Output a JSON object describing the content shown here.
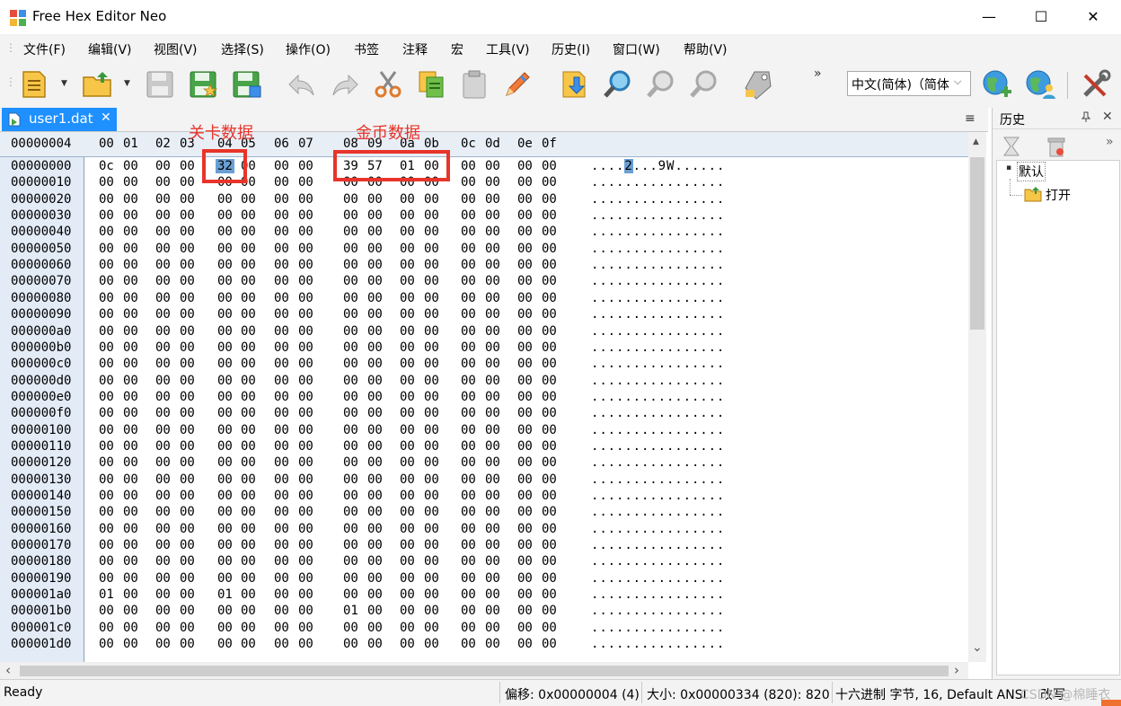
{
  "window": {
    "title": "Free Hex Editor Neo",
    "minimize_glyph": "—",
    "maximize_glyph": "☐",
    "close_glyph": "✕"
  },
  "menu": [
    "文件(F)",
    "编辑(V)",
    "视图(V)",
    "选择(S)",
    "操作(O)",
    "书签",
    "注释",
    "宏",
    "工具(V)",
    "历史(I)",
    "窗口(W)",
    "帮助(V)"
  ],
  "toolbar": {
    "icons": [
      "new-file-icon",
      "open-folder-icon",
      "save-disk-icon",
      "save-as-icon",
      "save-all-icon",
      "undo-icon",
      "redo-icon",
      "cut-scissors-icon",
      "copy-icon",
      "paste-icon",
      "edit-pencil-icon",
      "export-icon",
      "find-icon",
      "find-previous-icon",
      "find-next-icon",
      "tag-icon",
      "web-add-icon",
      "web-user-icon",
      "tools-icon"
    ],
    "overflow": "»",
    "language_select": "中文(简体)（简体",
    "language_chevron": "⌵"
  },
  "tab": {
    "label": "user1.dat",
    "close": "✕",
    "menu": "≡"
  },
  "hex": {
    "corner_offset": "00000004",
    "columns": [
      "00",
      "01",
      "02",
      "03",
      "04",
      "05",
      "06",
      "07",
      "08",
      "09",
      "0a",
      "0b",
      "0c",
      "0d",
      "0e",
      "0f"
    ],
    "rows": [
      {
        "offset": "00000000",
        "bytes": [
          "0c",
          "00",
          "00",
          "00",
          "32",
          "00",
          "00",
          "00",
          "39",
          "57",
          "01",
          "00",
          "00",
          "00",
          "00",
          "00"
        ],
        "ascii_pre": "....",
        "ascii_sel": "2",
        "ascii_post": "...9W......"
      },
      {
        "offset": "00000010",
        "bytes": [
          "00",
          "00",
          "00",
          "00",
          "00",
          "00",
          "00",
          "00",
          "00",
          "00",
          "00",
          "00",
          "00",
          "00",
          "00",
          "00"
        ],
        "ascii_pre": "................",
        "ascii_sel": "",
        "ascii_post": ""
      },
      {
        "offset": "00000020",
        "bytes": [
          "00",
          "00",
          "00",
          "00",
          "00",
          "00",
          "00",
          "00",
          "00",
          "00",
          "00",
          "00",
          "00",
          "00",
          "00",
          "00"
        ],
        "ascii_pre": "................",
        "ascii_sel": "",
        "ascii_post": ""
      },
      {
        "offset": "00000030",
        "bytes": [
          "00",
          "00",
          "00",
          "00",
          "00",
          "00",
          "00",
          "00",
          "00",
          "00",
          "00",
          "00",
          "00",
          "00",
          "00",
          "00"
        ],
        "ascii_pre": "................",
        "ascii_sel": "",
        "ascii_post": ""
      },
      {
        "offset": "00000040",
        "bytes": [
          "00",
          "00",
          "00",
          "00",
          "00",
          "00",
          "00",
          "00",
          "00",
          "00",
          "00",
          "00",
          "00",
          "00",
          "00",
          "00"
        ],
        "ascii_pre": "................",
        "ascii_sel": "",
        "ascii_post": ""
      },
      {
        "offset": "00000050",
        "bytes": [
          "00",
          "00",
          "00",
          "00",
          "00",
          "00",
          "00",
          "00",
          "00",
          "00",
          "00",
          "00",
          "00",
          "00",
          "00",
          "00"
        ],
        "ascii_pre": "................",
        "ascii_sel": "",
        "ascii_post": ""
      },
      {
        "offset": "00000060",
        "bytes": [
          "00",
          "00",
          "00",
          "00",
          "00",
          "00",
          "00",
          "00",
          "00",
          "00",
          "00",
          "00",
          "00",
          "00",
          "00",
          "00"
        ],
        "ascii_pre": "................",
        "ascii_sel": "",
        "ascii_post": ""
      },
      {
        "offset": "00000070",
        "bytes": [
          "00",
          "00",
          "00",
          "00",
          "00",
          "00",
          "00",
          "00",
          "00",
          "00",
          "00",
          "00",
          "00",
          "00",
          "00",
          "00"
        ],
        "ascii_pre": "................",
        "ascii_sel": "",
        "ascii_post": ""
      },
      {
        "offset": "00000080",
        "bytes": [
          "00",
          "00",
          "00",
          "00",
          "00",
          "00",
          "00",
          "00",
          "00",
          "00",
          "00",
          "00",
          "00",
          "00",
          "00",
          "00"
        ],
        "ascii_pre": "................",
        "ascii_sel": "",
        "ascii_post": ""
      },
      {
        "offset": "00000090",
        "bytes": [
          "00",
          "00",
          "00",
          "00",
          "00",
          "00",
          "00",
          "00",
          "00",
          "00",
          "00",
          "00",
          "00",
          "00",
          "00",
          "00"
        ],
        "ascii_pre": "................",
        "ascii_sel": "",
        "ascii_post": ""
      },
      {
        "offset": "000000a0",
        "bytes": [
          "00",
          "00",
          "00",
          "00",
          "00",
          "00",
          "00",
          "00",
          "00",
          "00",
          "00",
          "00",
          "00",
          "00",
          "00",
          "00"
        ],
        "ascii_pre": "................",
        "ascii_sel": "",
        "ascii_post": ""
      },
      {
        "offset": "000000b0",
        "bytes": [
          "00",
          "00",
          "00",
          "00",
          "00",
          "00",
          "00",
          "00",
          "00",
          "00",
          "00",
          "00",
          "00",
          "00",
          "00",
          "00"
        ],
        "ascii_pre": "................",
        "ascii_sel": "",
        "ascii_post": ""
      },
      {
        "offset": "000000c0",
        "bytes": [
          "00",
          "00",
          "00",
          "00",
          "00",
          "00",
          "00",
          "00",
          "00",
          "00",
          "00",
          "00",
          "00",
          "00",
          "00",
          "00"
        ],
        "ascii_pre": "................",
        "ascii_sel": "",
        "ascii_post": ""
      },
      {
        "offset": "000000d0",
        "bytes": [
          "00",
          "00",
          "00",
          "00",
          "00",
          "00",
          "00",
          "00",
          "00",
          "00",
          "00",
          "00",
          "00",
          "00",
          "00",
          "00"
        ],
        "ascii_pre": "................",
        "ascii_sel": "",
        "ascii_post": ""
      },
      {
        "offset": "000000e0",
        "bytes": [
          "00",
          "00",
          "00",
          "00",
          "00",
          "00",
          "00",
          "00",
          "00",
          "00",
          "00",
          "00",
          "00",
          "00",
          "00",
          "00"
        ],
        "ascii_pre": "................",
        "ascii_sel": "",
        "ascii_post": ""
      },
      {
        "offset": "000000f0",
        "bytes": [
          "00",
          "00",
          "00",
          "00",
          "00",
          "00",
          "00",
          "00",
          "00",
          "00",
          "00",
          "00",
          "00",
          "00",
          "00",
          "00"
        ],
        "ascii_pre": "................",
        "ascii_sel": "",
        "ascii_post": ""
      },
      {
        "offset": "00000100",
        "bytes": [
          "00",
          "00",
          "00",
          "00",
          "00",
          "00",
          "00",
          "00",
          "00",
          "00",
          "00",
          "00",
          "00",
          "00",
          "00",
          "00"
        ],
        "ascii_pre": "................",
        "ascii_sel": "",
        "ascii_post": ""
      },
      {
        "offset": "00000110",
        "bytes": [
          "00",
          "00",
          "00",
          "00",
          "00",
          "00",
          "00",
          "00",
          "00",
          "00",
          "00",
          "00",
          "00",
          "00",
          "00",
          "00"
        ],
        "ascii_pre": "................",
        "ascii_sel": "",
        "ascii_post": ""
      },
      {
        "offset": "00000120",
        "bytes": [
          "00",
          "00",
          "00",
          "00",
          "00",
          "00",
          "00",
          "00",
          "00",
          "00",
          "00",
          "00",
          "00",
          "00",
          "00",
          "00"
        ],
        "ascii_pre": "................",
        "ascii_sel": "",
        "ascii_post": ""
      },
      {
        "offset": "00000130",
        "bytes": [
          "00",
          "00",
          "00",
          "00",
          "00",
          "00",
          "00",
          "00",
          "00",
          "00",
          "00",
          "00",
          "00",
          "00",
          "00",
          "00"
        ],
        "ascii_pre": "................",
        "ascii_sel": "",
        "ascii_post": ""
      },
      {
        "offset": "00000140",
        "bytes": [
          "00",
          "00",
          "00",
          "00",
          "00",
          "00",
          "00",
          "00",
          "00",
          "00",
          "00",
          "00",
          "00",
          "00",
          "00",
          "00"
        ],
        "ascii_pre": "................",
        "ascii_sel": "",
        "ascii_post": ""
      },
      {
        "offset": "00000150",
        "bytes": [
          "00",
          "00",
          "00",
          "00",
          "00",
          "00",
          "00",
          "00",
          "00",
          "00",
          "00",
          "00",
          "00",
          "00",
          "00",
          "00"
        ],
        "ascii_pre": "................",
        "ascii_sel": "",
        "ascii_post": ""
      },
      {
        "offset": "00000160",
        "bytes": [
          "00",
          "00",
          "00",
          "00",
          "00",
          "00",
          "00",
          "00",
          "00",
          "00",
          "00",
          "00",
          "00",
          "00",
          "00",
          "00"
        ],
        "ascii_pre": "................",
        "ascii_sel": "",
        "ascii_post": ""
      },
      {
        "offset": "00000170",
        "bytes": [
          "00",
          "00",
          "00",
          "00",
          "00",
          "00",
          "00",
          "00",
          "00",
          "00",
          "00",
          "00",
          "00",
          "00",
          "00",
          "00"
        ],
        "ascii_pre": "................",
        "ascii_sel": "",
        "ascii_post": ""
      },
      {
        "offset": "00000180",
        "bytes": [
          "00",
          "00",
          "00",
          "00",
          "00",
          "00",
          "00",
          "00",
          "00",
          "00",
          "00",
          "00",
          "00",
          "00",
          "00",
          "00"
        ],
        "ascii_pre": "................",
        "ascii_sel": "",
        "ascii_post": ""
      },
      {
        "offset": "00000190",
        "bytes": [
          "00",
          "00",
          "00",
          "00",
          "00",
          "00",
          "00",
          "00",
          "00",
          "00",
          "00",
          "00",
          "00",
          "00",
          "00",
          "00"
        ],
        "ascii_pre": "................",
        "ascii_sel": "",
        "ascii_post": ""
      },
      {
        "offset": "000001a0",
        "bytes": [
          "01",
          "00",
          "00",
          "00",
          "01",
          "00",
          "00",
          "00",
          "00",
          "00",
          "00",
          "00",
          "00",
          "00",
          "00",
          "00"
        ],
        "ascii_pre": "................",
        "ascii_sel": "",
        "ascii_post": ""
      },
      {
        "offset": "000001b0",
        "bytes": [
          "00",
          "00",
          "00",
          "00",
          "00",
          "00",
          "00",
          "00",
          "01",
          "00",
          "00",
          "00",
          "00",
          "00",
          "00",
          "00"
        ],
        "ascii_pre": "................",
        "ascii_sel": "",
        "ascii_post": ""
      },
      {
        "offset": "000001c0",
        "bytes": [
          "00",
          "00",
          "00",
          "00",
          "00",
          "00",
          "00",
          "00",
          "00",
          "00",
          "00",
          "00",
          "00",
          "00",
          "00",
          "00"
        ],
        "ascii_pre": "................",
        "ascii_sel": "",
        "ascii_post": ""
      },
      {
        "offset": "000001d0",
        "bytes": [
          "00",
          "00",
          "00",
          "00",
          "00",
          "00",
          "00",
          "00",
          "00",
          "00",
          "00",
          "00",
          "00",
          "00",
          "00",
          "00"
        ],
        "ascii_pre": "................",
        "ascii_sel": "",
        "ascii_post": ""
      }
    ],
    "selected_color": "#6a9fd4"
  },
  "annotations": {
    "level_label": "关卡数据",
    "coins_label": "金币数据",
    "color": "#e8342a"
  },
  "scroll": {
    "up": "▲",
    "down": "⌄",
    "left": "‹",
    "right": "›"
  },
  "side_panel": {
    "title": "历史",
    "pin": "📌",
    "close": "✕",
    "overflow": "»",
    "tree_root": "默认",
    "tree_child": "打开",
    "expander": "▪"
  },
  "status": {
    "ready": "Ready",
    "offset": "偏移: 0x00000004 (4)",
    "size": "大小: 0x00000334 (820): 820",
    "mode": "十六进制 字节, 16, Default ANSI",
    "edit_mode": "改写",
    "watermark": "CSDN @棉睡衣"
  }
}
